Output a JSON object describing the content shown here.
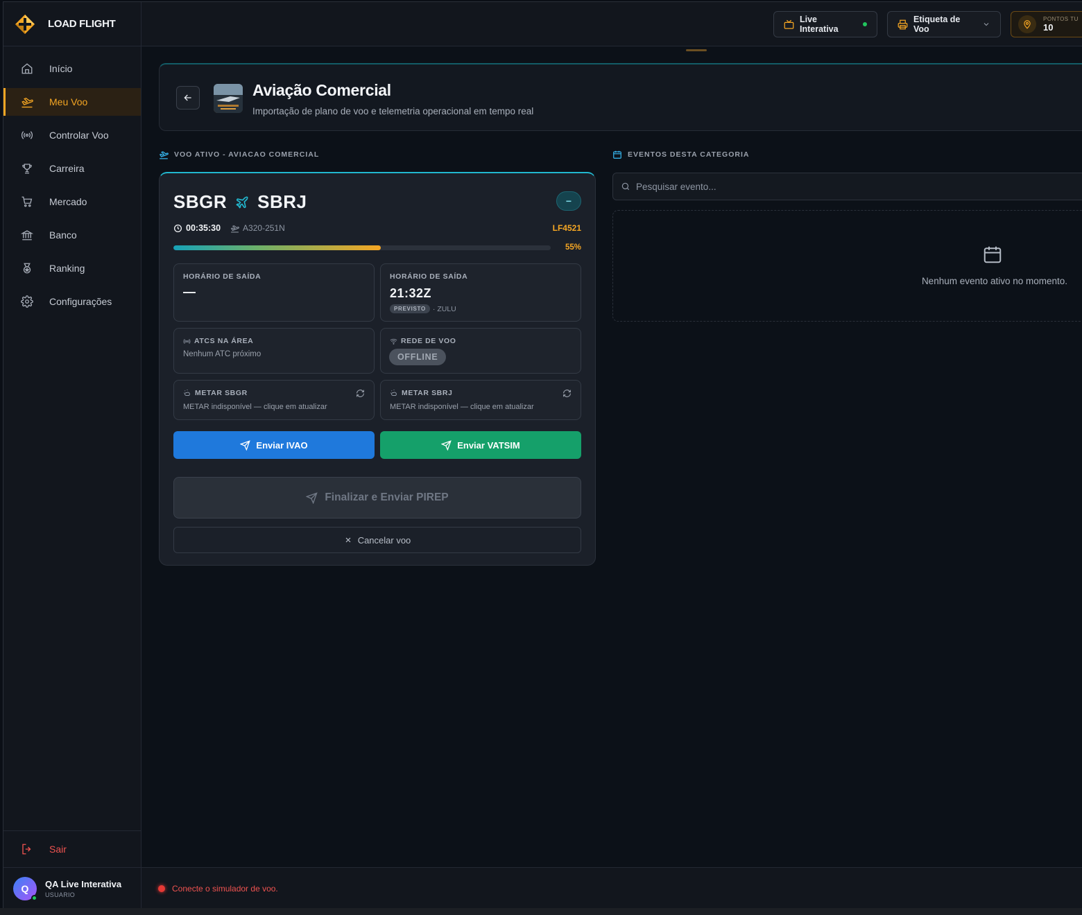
{
  "brand": {
    "name": "LOAD FLIGHT"
  },
  "sidebar": {
    "items": [
      {
        "label": "Início",
        "icon": "home-icon"
      },
      {
        "label": "Meu Voo",
        "icon": "plane-takeoff-icon",
        "active": true
      },
      {
        "label": "Controlar Voo",
        "icon": "radio-icon"
      },
      {
        "label": "Carreira",
        "icon": "trophy-icon"
      },
      {
        "label": "Mercado",
        "icon": "cart-icon"
      },
      {
        "label": "Banco",
        "icon": "bank-icon"
      },
      {
        "label": "Ranking",
        "icon": "medal-icon"
      },
      {
        "label": "Configurações",
        "icon": "gear-icon"
      }
    ],
    "logout_label": "Sair"
  },
  "user": {
    "initial": "Q",
    "name": "QA Live Interativa",
    "role": "USUARIO"
  },
  "topbar": {
    "live_label": "Live Interativa",
    "label_button": "Etiqueta de Voo",
    "points_label": "PONTOS TU",
    "points_value": "10"
  },
  "header": {
    "title": "Aviação Comercial",
    "subtitle": "Importação de plano de voo e telemetria operacional em tempo real"
  },
  "flight": {
    "section_label": "VOO ATIVO - AVIACAO COMERCIAL",
    "origin": "SBGR",
    "destination": "SBRJ",
    "collapse_label": "−",
    "timer": "00:35:30",
    "aircraft": "A320-251N",
    "callsign": "LF4521",
    "progress": 0.55,
    "progress_label": "55%",
    "departure_left": {
      "label": "HORÁRIO DE SAÍDA",
      "value": "—"
    },
    "departure_right": {
      "label": "HORÁRIO DE SAÍDA",
      "value": "21:32Z",
      "badge": "PREVISTO",
      "suffix": "· ZULU"
    },
    "atc": {
      "label": "ATCS NA ÁREA",
      "text": "Nenhum ATC próximo"
    },
    "network": {
      "label": "REDE DE VOO",
      "status": "OFFLINE"
    },
    "metar_origin": {
      "label": "METAR SBGR",
      "text": "METAR indisponível — clique em atualizar"
    },
    "metar_dest": {
      "label": "METAR SBRJ",
      "text": "METAR indisponível — clique em atualizar"
    },
    "send_ivao": "Enviar IVAO",
    "send_vatsim": "Enviar VATSIM",
    "finish_pirep": "Finalizar e Enviar PIREP",
    "cancel": "Cancelar voo"
  },
  "events": {
    "section_label": "EVENTOS DESTA CATEGORIA",
    "search_placeholder": "Pesquisar evento...",
    "empty_text": "Nenhum evento ativo no momento."
  },
  "status": {
    "text": "Conecte o simulador de voo."
  },
  "colors": {
    "accent": "#f5a623",
    "teal": "#22b8cf",
    "ivao": "#1f79dc",
    "vatsim": "#15a06a",
    "danger": "#ef5350"
  }
}
